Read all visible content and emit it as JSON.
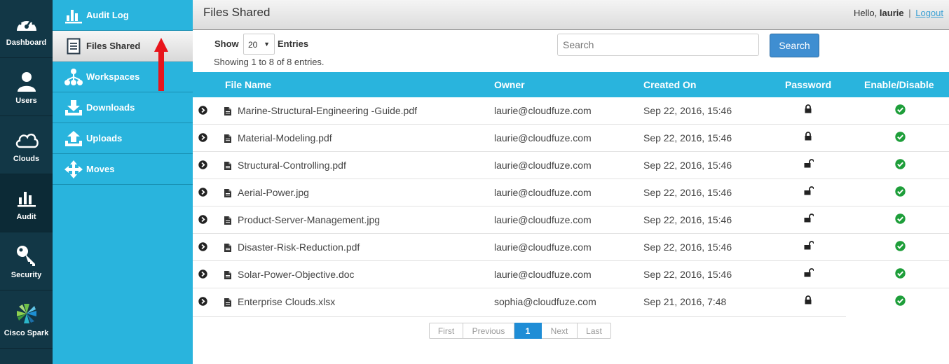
{
  "rail": {
    "items": [
      {
        "label": "Dashboard",
        "icon": "dashboard-gauge-icon"
      },
      {
        "label": "Users",
        "icon": "user-icon"
      },
      {
        "label": "Clouds",
        "icon": "cloud-icon"
      },
      {
        "label": "Audit",
        "icon": "bar-chart-icon"
      },
      {
        "label": "Security",
        "icon": "key-icon"
      },
      {
        "label": "Cisco Spark",
        "icon": "cisco-spark-logo-icon"
      }
    ],
    "active": "Audit"
  },
  "submenu": {
    "items": [
      {
        "label": "Audit Log",
        "icon": "bar-chart-icon"
      },
      {
        "label": "Files Shared",
        "icon": "document-icon"
      },
      {
        "label": "Workspaces",
        "icon": "hierarchy-icon"
      },
      {
        "label": "Downloads",
        "icon": "download-icon"
      },
      {
        "label": "Uploads",
        "icon": "upload-icon"
      },
      {
        "label": "Moves",
        "icon": "move-arrows-icon"
      }
    ],
    "active": "Files Shared"
  },
  "header": {
    "title": "Files Shared",
    "hello": "Hello,",
    "username": "laurie",
    "separator": "|",
    "logout": "Logout"
  },
  "controls": {
    "show_label": "Show",
    "entries_value": "20",
    "entries_label": "Entries",
    "showing_text": "Showing 1 to 8 of 8 entries.",
    "search_placeholder": "Search",
    "search_button": "Search"
  },
  "table": {
    "headers": {
      "file_name": "File Name",
      "owner": "Owner",
      "created_on": "Created On",
      "password": "Password",
      "enable_disable": "Enable/Disable"
    },
    "rows": [
      {
        "file": "Marine-Structural-Engineering -Guide.pdf",
        "owner": "laurie@cloudfuze.com",
        "created": "Sep 22, 2016, 15:46",
        "password": "locked",
        "enabled": true
      },
      {
        "file": "Material-Modeling.pdf",
        "owner": "laurie@cloudfuze.com",
        "created": "Sep 22, 2016, 15:46",
        "password": "locked",
        "enabled": true
      },
      {
        "file": "Structural-Controlling.pdf",
        "owner": "laurie@cloudfuze.com",
        "created": "Sep 22, 2016, 15:46",
        "password": "unlocked",
        "enabled": true
      },
      {
        "file": "Aerial-Power.jpg",
        "owner": "laurie@cloudfuze.com",
        "created": "Sep 22, 2016, 15:46",
        "password": "unlocked",
        "enabled": true
      },
      {
        "file": "Product-Server-Management.jpg",
        "owner": "laurie@cloudfuze.com",
        "created": "Sep 22, 2016, 15:46",
        "password": "unlocked",
        "enabled": true
      },
      {
        "file": "Disaster-Risk-Reduction.pdf",
        "owner": "laurie@cloudfuze.com",
        "created": "Sep 22, 2016, 15:46",
        "password": "unlocked",
        "enabled": true
      },
      {
        "file": "Solar-Power-Objective.doc",
        "owner": "laurie@cloudfuze.com",
        "created": "Sep 22, 2016, 15:46",
        "password": "unlocked",
        "enabled": true
      },
      {
        "file": "Enterprise Clouds.xlsx",
        "owner": "sophia@cloudfuze.com",
        "created": "Sep 21, 2016, 7:48",
        "password": "locked",
        "enabled": true
      }
    ]
  },
  "pagination": {
    "first": "First",
    "previous": "Previous",
    "current": "1",
    "next": "Next",
    "last": "Last"
  },
  "colors": {
    "rail_bg": "#123746",
    "submenu_bg": "#29b4dd",
    "header_row_bg": "#29b4dd",
    "search_button": "#3f8ed1",
    "enabled_check": "#1e9e3a",
    "annotation_arrow": "#e8141b"
  }
}
